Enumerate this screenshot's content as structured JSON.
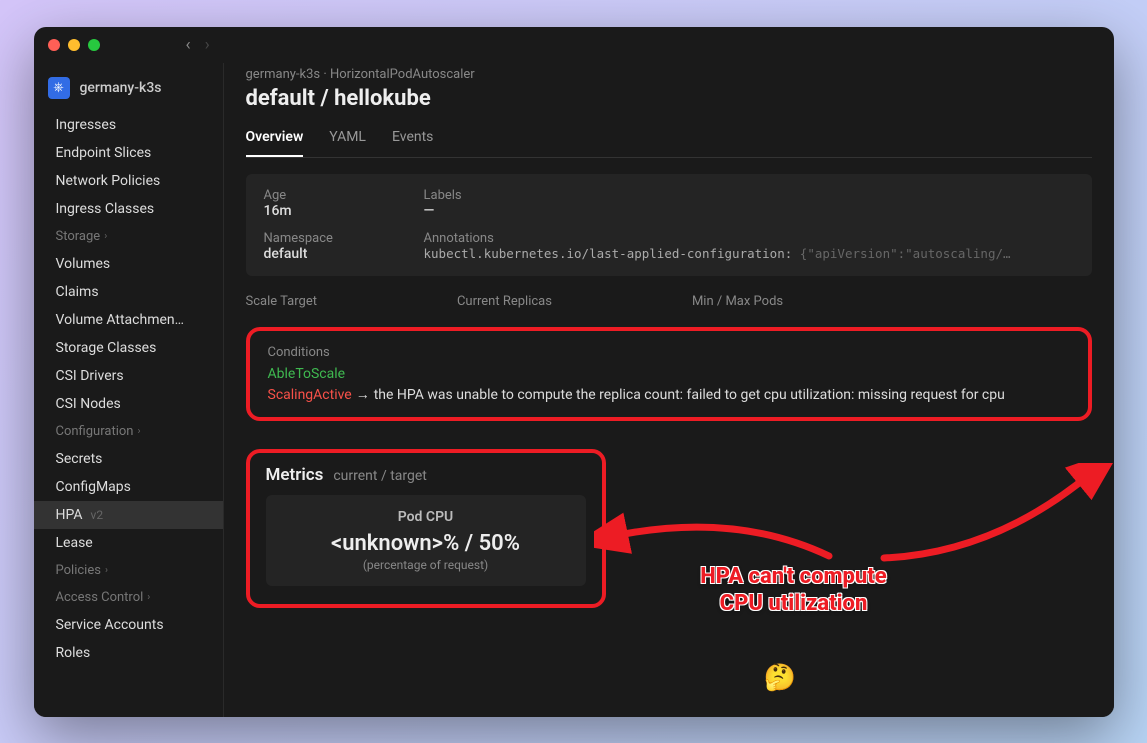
{
  "cluster": {
    "name": "germany-k3s"
  },
  "sidebar": {
    "items_top": [
      "Ingresses",
      "Endpoint Slices",
      "Network Policies",
      "Ingress Classes"
    ],
    "group_storage": "Storage",
    "items_storage": [
      "Volumes",
      "Claims",
      "Volume Attachmen…",
      "Storage Classes",
      "CSI Drivers",
      "CSI Nodes"
    ],
    "group_config": "Configuration",
    "items_config": [
      {
        "label": "Secrets",
        "version": "",
        "active": false
      },
      {
        "label": "ConfigMaps",
        "version": "",
        "active": false
      },
      {
        "label": "HPA",
        "version": "v2",
        "active": true
      },
      {
        "label": "Lease",
        "version": "",
        "active": false
      }
    ],
    "group_policies": "Policies",
    "group_access": "Access Control",
    "items_access": [
      "Service Accounts",
      "Roles"
    ]
  },
  "breadcrumb": {
    "cluster": "germany-k3s",
    "sep": "·",
    "kind": "HorizontalPodAutoscaler"
  },
  "title": "default / hellokube",
  "tabs": [
    {
      "label": "Overview",
      "active": true
    },
    {
      "label": "YAML",
      "active": false
    },
    {
      "label": "Events",
      "active": false
    }
  ],
  "info": {
    "age_label": "Age",
    "age_value": "16m",
    "labels_label": "Labels",
    "labels_value": "—",
    "ns_label": "Namespace",
    "ns_value": "default",
    "anno_label": "Annotations",
    "anno_key": "kubectl.kubernetes.io/last-applied-configuration:",
    "anno_json": "{\"apiVersion\":\"autoscaling/…"
  },
  "cols": {
    "scale": "Scale Target",
    "replicas": "Current Replicas",
    "minmax": "Min / Max Pods"
  },
  "conditions": {
    "label": "Conditions",
    "ok": "AbleToScale",
    "err_name": "ScalingActive",
    "arrow": "→",
    "err_msg": "the HPA was unable to compute the replica count: failed to get cpu utilization: missing request for cpu"
  },
  "metrics": {
    "title": "Metrics",
    "subtitle": "current / target",
    "card": {
      "name": "Pod CPU",
      "value": "<unknown>% / 50%",
      "note": "(percentage of request)"
    }
  },
  "annotation": {
    "line1": "HPA can't compute",
    "line2": "CPU utilization"
  },
  "emoji": "🤔"
}
